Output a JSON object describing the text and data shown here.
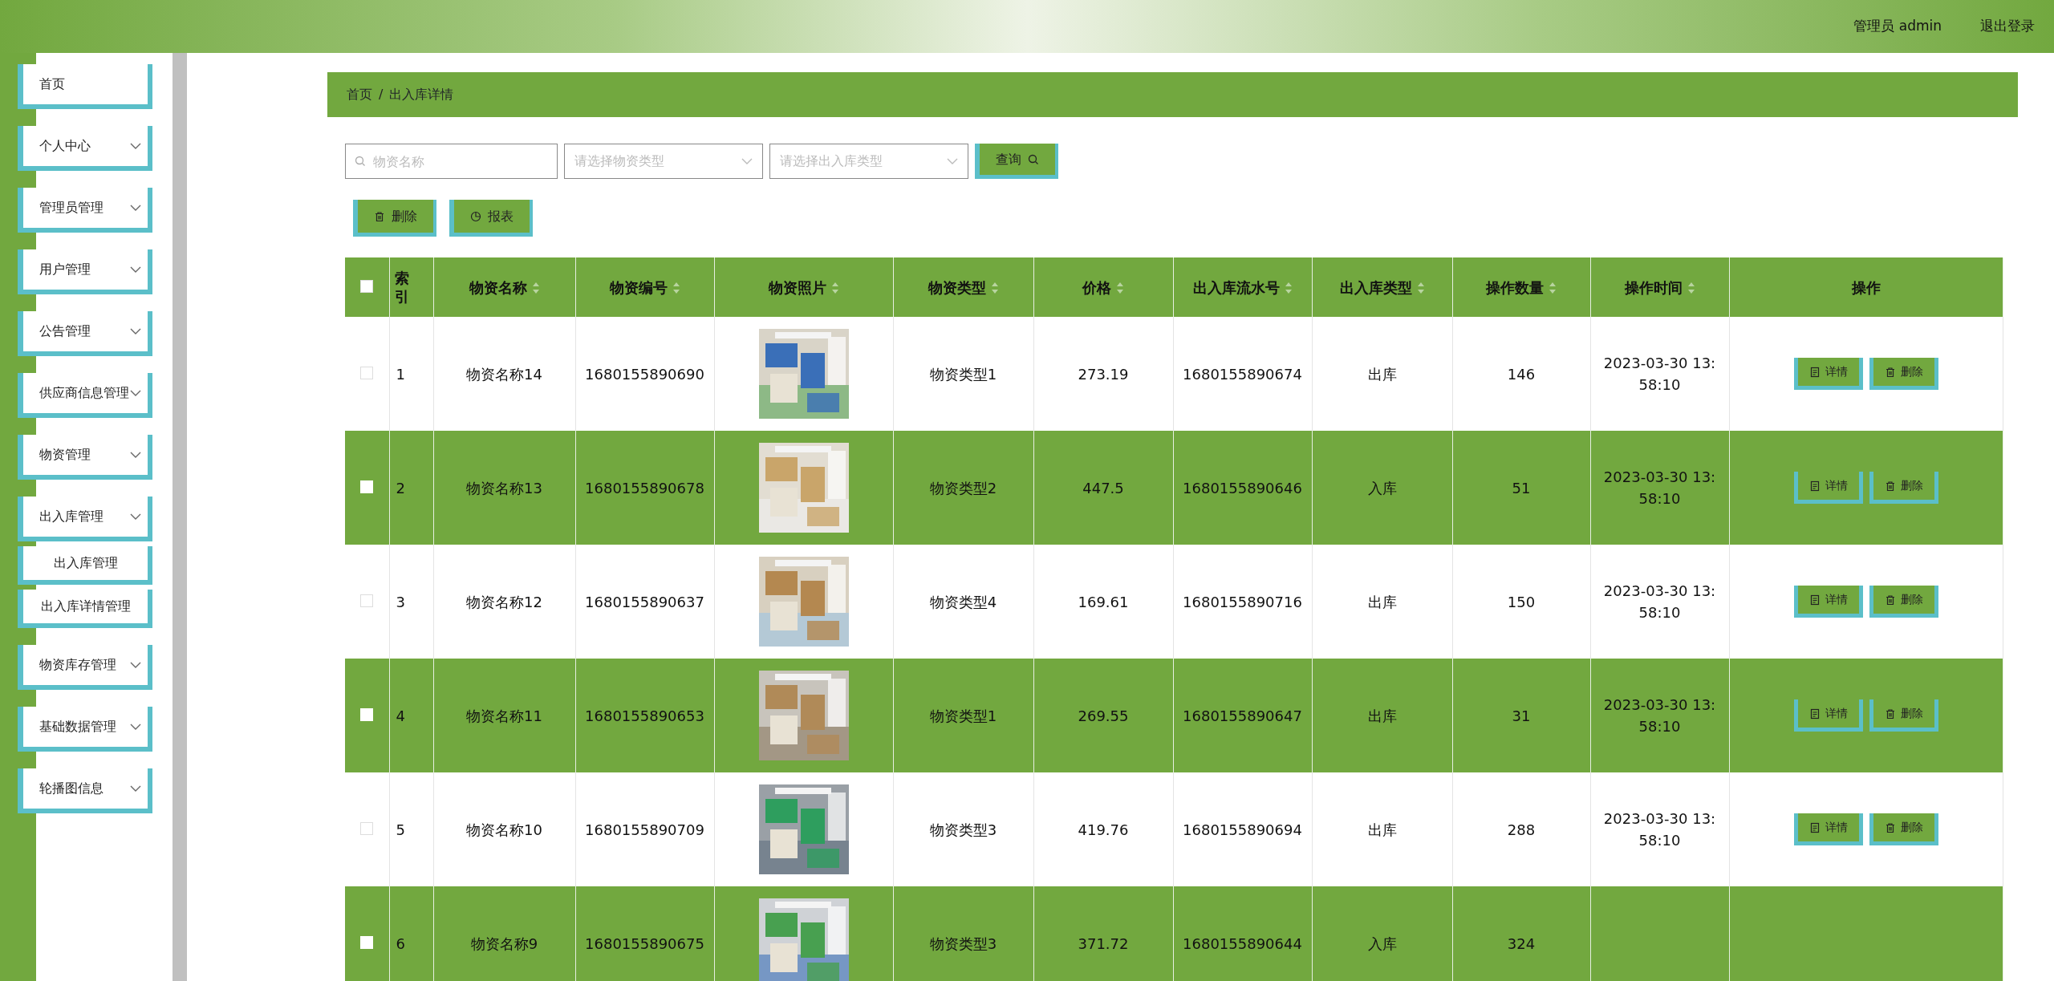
{
  "header": {
    "user": "管理员 admin",
    "logout": "退出登录"
  },
  "sidebar": {
    "items": [
      {
        "label": "首页",
        "dropdown": false
      },
      {
        "label": "个人中心",
        "dropdown": true
      },
      {
        "label": "管理员管理",
        "dropdown": true
      },
      {
        "label": "用户管理",
        "dropdown": true
      },
      {
        "label": "公告管理",
        "dropdown": true
      },
      {
        "label": "供应商信息管理",
        "dropdown": true
      },
      {
        "label": "物资管理",
        "dropdown": true
      },
      {
        "label": "出入库管理",
        "dropdown": true,
        "children": [
          {
            "label": "出入库管理"
          },
          {
            "label": "出入库详情管理"
          }
        ]
      },
      {
        "label": "物资库存管理",
        "dropdown": true
      },
      {
        "label": "基础数据管理",
        "dropdown": true
      },
      {
        "label": "轮播图信息",
        "dropdown": true
      }
    ]
  },
  "breadcrumb": {
    "items": [
      "首页",
      "出入库详情"
    ],
    "separator": "/"
  },
  "search": {
    "name": {
      "placeholder": "物资名称"
    },
    "type_select": {
      "placeholder": "请选择物资类型"
    },
    "io_select": {
      "placeholder": "请选择出入库类型"
    },
    "button": "查询"
  },
  "actions": [
    {
      "label": "删除"
    },
    {
      "label": "报表"
    }
  ],
  "table": {
    "select_all": {
      "checked": false
    },
    "columns": [
      {
        "label": "索引",
        "sortable": false
      },
      {
        "label": "物资名称",
        "sortable": true
      },
      {
        "label": "物资编号",
        "sortable": true
      },
      {
        "label": "物资照片",
        "sortable": true
      },
      {
        "label": "物资类型",
        "sortable": true
      },
      {
        "label": "价格",
        "sortable": true
      },
      {
        "label": "出入库流水号",
        "sortable": true
      },
      {
        "label": "出入库类型",
        "sortable": true
      },
      {
        "label": "操作数量",
        "sortable": true
      },
      {
        "label": "操作时间",
        "sortable": true
      },
      {
        "label": "操作",
        "sortable": false
      }
    ],
    "rows": [
      {
        "checked": false,
        "index": "1",
        "name": "物资名称14",
        "code": "1680155890690",
        "type": "物资类型1",
        "price": "273.19",
        "serial": "1680155890674",
        "io_type": "出库",
        "quantity": "146",
        "time": "2023-03-30 13:58:10",
        "buttons": [
          "详情",
          "删除"
        ]
      },
      {
        "checked": false,
        "index": "2",
        "name": "物资名称13",
        "code": "1680155890678",
        "type": "物资类型2",
        "price": "447.5",
        "serial": "1680155890646",
        "io_type": "入库",
        "quantity": "51",
        "time": "2023-03-30 13:58:10",
        "buttons": [
          "详情",
          "删除"
        ]
      },
      {
        "checked": false,
        "index": "3",
        "name": "物资名称12",
        "code": "1680155890637",
        "type": "物资类型4",
        "price": "169.61",
        "serial": "1680155890716",
        "io_type": "出库",
        "quantity": "150",
        "time": "2023-03-30 13:58:10",
        "buttons": [
          "详情",
          "删除"
        ]
      },
      {
        "checked": false,
        "index": "4",
        "name": "物资名称11",
        "code": "1680155890653",
        "type": "物资类型1",
        "price": "269.55",
        "serial": "1680155890647",
        "io_type": "出库",
        "quantity": "31",
        "time": "2023-03-30 13:58:10",
        "buttons": [
          "详情",
          "删除"
        ]
      },
      {
        "checked": false,
        "index": "5",
        "name": "物资名称10",
        "code": "1680155890709",
        "type": "物资类型3",
        "price": "419.76",
        "serial": "1680155890694",
        "io_type": "出库",
        "quantity": "288",
        "time": "2023-03-30 13:58:10",
        "buttons": [
          "详情",
          "删除"
        ]
      },
      {
        "checked": false,
        "index": "6",
        "name": "物资名称9",
        "code": "1680155890675",
        "type": "物资类型3",
        "price": "371.72",
        "serial": "1680155890644",
        "io_type": "入库",
        "quantity": "324"
      }
    ]
  }
}
